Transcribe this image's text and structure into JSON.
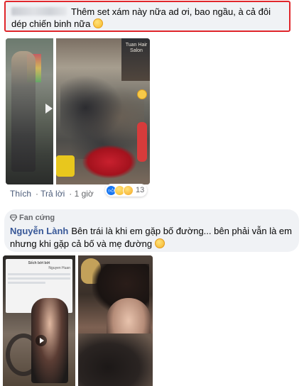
{
  "comment1": {
    "text": "Thêm set xám này nữa ad ơi, bao ngầu, à cả đôi dép chiến binh nữa",
    "emoji": "rolling-on-floor-laughing-emoji"
  },
  "media1": {
    "shop_sign": "Tuan Hair Salon"
  },
  "comment1_actions": {
    "like": "Thích",
    "reply": "Trả lời",
    "time": "1 giờ",
    "reaction_count": "13",
    "reactions": [
      "like",
      "haha",
      "wow"
    ]
  },
  "comment2": {
    "badge": "Fan cứng",
    "author": "Nguyễn Lành",
    "text": "Bên trái là khi em gặp bố đường... bên phải vẫn là em nhưng khi gặp cả bố và mẹ đường",
    "emoji": "flushed-face-emoji"
  },
  "media2": {
    "phone_title": "Sếch bởi bởi",
    "phone_user": "Nguyen Huan"
  },
  "colors": {
    "highlight_border": "#e0262b",
    "bubble_bg": "#f0f2f5",
    "author_link": "#385898",
    "meta_text": "#65676b"
  }
}
